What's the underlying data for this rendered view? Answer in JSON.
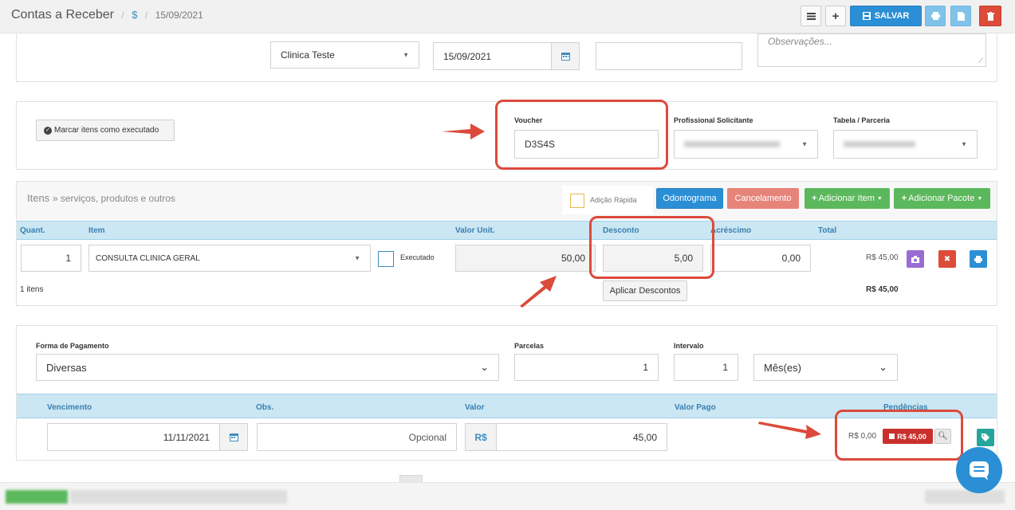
{
  "header": {
    "title": "Contas a Receber",
    "separator": "/",
    "currency_symbol": "$",
    "date": "15/09/2021",
    "save_label": "SALVAR",
    "list_icon": "list-icon",
    "plus_icon": "plus-icon",
    "print_icon": "print-icon",
    "file_icon": "file-icon",
    "trash_icon": "trash-icon"
  },
  "top_form": {
    "clinic_select": "Clinica Teste",
    "date_value": "15/09/2021",
    "observations_placeholder": "Observações..."
  },
  "voucher_section": {
    "mark_executed_button": "Marcar itens como executado",
    "voucher_label": "Voucher",
    "voucher_value": "D3S4S",
    "profissional_label": "Profissional Solicitante",
    "tabela_label": "Tabela / Parceria"
  },
  "items": {
    "title": "Itens",
    "subtitle": "» serviços, produtos e outros",
    "quick_add_label": "Adição Rápida",
    "odontograma_button": "Odontograma",
    "cancelamento_button": "Cancelamento",
    "add_item_button": "Adicionar Item",
    "add_package_button": "Adicionar Pacote",
    "columns": {
      "quant": "Quant.",
      "item": "Item",
      "valor_unit": "Valor Unit.",
      "desconto": "Desconto",
      "acrescimo": "Acréscimo",
      "total": "Total"
    },
    "row": {
      "quantity": "1",
      "item": "CONSULTA CLINICA GERAL",
      "executed_label": "Executado",
      "unit_value": "50,00",
      "discount": "5,00",
      "increase": "0,00",
      "total": "R$ 45,00"
    },
    "count_label": "1 itens",
    "apply_discounts_button": "Aplicar Descontos",
    "grand_total": "R$ 45,00"
  },
  "payment": {
    "forma_label": "Forma de Pagamento",
    "forma_value": "Diversas",
    "parcelas_label": "Parcelas",
    "parcelas_value": "1",
    "intervalo_label": "Intervalo",
    "intervalo_value": "1",
    "period_value": "Mês(es)",
    "columns": {
      "vencimento": "Vencimento",
      "obs": "Obs.",
      "valor": "Valor",
      "valor_pago": "Valor Pago",
      "pendencias": "Pendências"
    },
    "row": {
      "due_date": "11/11/2021",
      "obs_placeholder": "Opcional",
      "currency": "R$",
      "value": "45,00",
      "paid": "R$ 0,00",
      "pending": "R$ 45,00"
    }
  },
  "colors": {
    "annotation_red": "#dc4a3c",
    "primary_blue": "#2b8fd6",
    "success_green": "#5cb85c",
    "danger_red": "#dd4b39",
    "header_blue": "#cbe7f3"
  }
}
